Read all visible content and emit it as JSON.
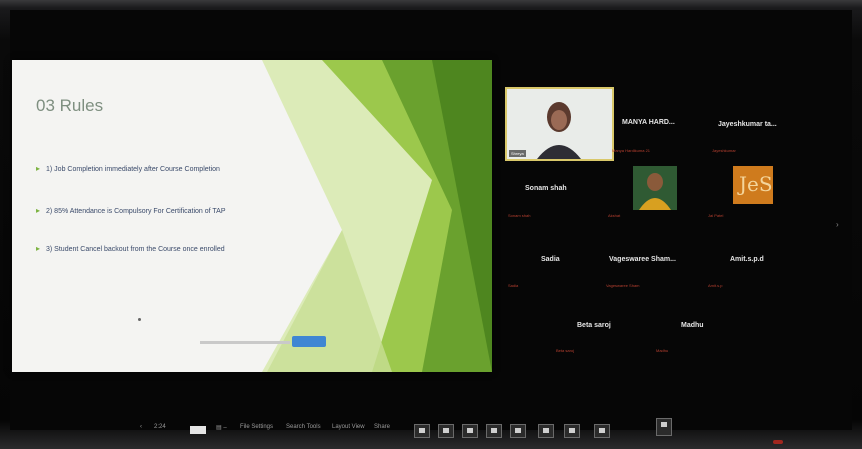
{
  "slide": {
    "title": "03 Rules",
    "bullets": [
      "1) Job Completion immediately after Course Completion",
      "2) 85% Attendance is Compulsory For Certification of TAP",
      "3) Student Cancel backout from the Course once enrolled"
    ]
  },
  "participants": {
    "video": {
      "label": "Shreya"
    },
    "tiles": [
      {
        "name": "MANYA HARD...",
        "sub": "Manya Hardikuma 21"
      },
      {
        "name": "Jayeshkumar ta...",
        "sub": "Jayeshkumar"
      },
      {
        "name": "Sonam shah",
        "sub": "Sonam shah"
      },
      {
        "name": "",
        "sub": "Akshat"
      },
      {
        "name": "",
        "sub": "Jai Patel"
      },
      {
        "name": "Sadia",
        "sub": "Sadia"
      },
      {
        "name": "Vageswaree Sham...",
        "sub": "Vageswaree Sham"
      },
      {
        "name": "Amit.s.p.d",
        "sub": "Amit.s.p"
      },
      {
        "name": "Beta saroj",
        "sub": "Beta saroj"
      },
      {
        "name": "Madhu",
        "sub": "Madhu"
      }
    ],
    "logo_text": "JeS"
  },
  "taskbar": {
    "items": [
      "‹",
      "2:24",
      "▤ –",
      "File Settings",
      "Search Tools",
      "Layout View",
      "Share"
    ],
    "time": "2:24"
  },
  "colors": {
    "slide_green": "#7bb23f",
    "slide_text": "#3a4a6a",
    "video_border": "#d9c86a",
    "button_blue": "#3f86d3"
  }
}
